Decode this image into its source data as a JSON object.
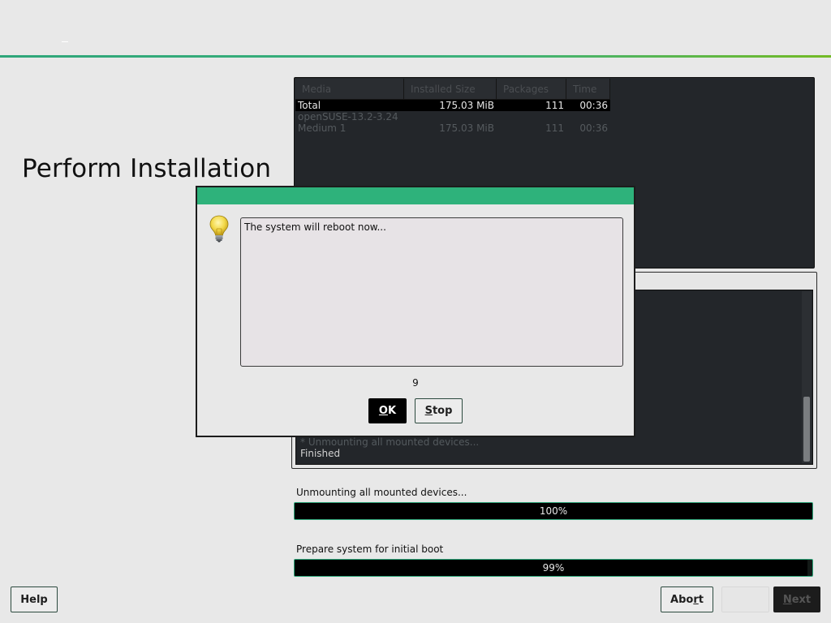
{
  "page": {
    "title": "Perform Installation"
  },
  "media_table": {
    "columns": [
      "Media",
      "Installed Size",
      "Packages",
      "Time"
    ],
    "rows": [
      {
        "media": "Total",
        "size": "175.03 MiB",
        "packages": "111",
        "time": "00:36",
        "selected": true
      },
      {
        "media": "openSUSE-13.2-3.24",
        "size": "",
        "packages": "",
        "time": "",
        "selected": false
      },
      {
        "media": "Medium 1",
        "size": "175.03 MiB",
        "packages": "111",
        "time": "00:36",
        "selected": false
      }
    ]
  },
  "log": {
    "lines": [
      "* Unmounting all mounted devices...",
      "Finished"
    ]
  },
  "progress": [
    {
      "label": "Unmounting all mounted devices...",
      "value_percent": 100,
      "text": "100%"
    },
    {
      "label": "Prepare system for initial boot",
      "value_percent": 99,
      "text": "99%"
    }
  ],
  "buttons": {
    "help": "Help",
    "abort_pre": "Abo",
    "abort_ul": "r",
    "abort_post": "t",
    "back": "",
    "next_ul": "N",
    "next_post": "ext"
  },
  "dialog": {
    "icon": "lightbulb-icon",
    "message": "The system will reboot now...",
    "countdown": "9",
    "ok_ul": "O",
    "ok_post": "K",
    "stop_ul": "S",
    "stop_post": "top"
  },
  "colors": {
    "accent": "#2eb27b",
    "dark_panel": "#23262a",
    "background": "#e8e8e8"
  }
}
